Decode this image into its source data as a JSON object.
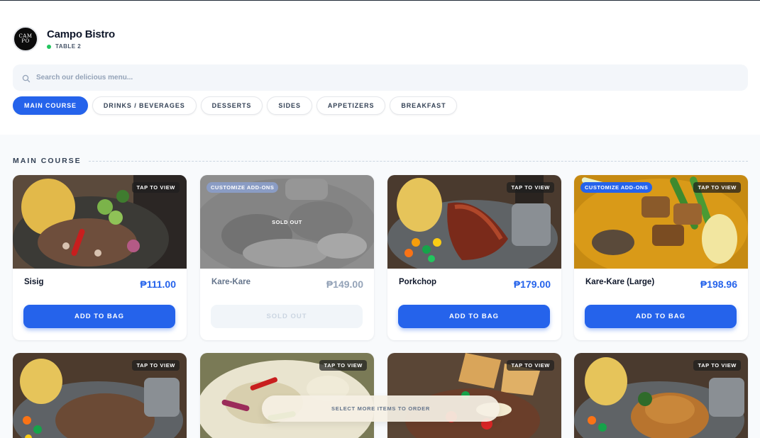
{
  "brand": {
    "name": "Campo Bistro",
    "logo_text": "CAM PO",
    "table": "TABLE 2",
    "table_status_color": "#22c55e"
  },
  "search": {
    "placeholder": "Search our delicious menu..."
  },
  "tabs": [
    {
      "label": "MAIN COURSE",
      "active": true
    },
    {
      "label": "DRINKS / BEVERAGES",
      "active": false
    },
    {
      "label": "DESSERTS",
      "active": false
    },
    {
      "label": "SIDES",
      "active": false
    },
    {
      "label": "APPETIZERS",
      "active": false
    },
    {
      "label": "BREAKFAST",
      "active": false
    }
  ],
  "section": {
    "title": "MAIN COURSE"
  },
  "products": [
    {
      "name": "Sisig",
      "price": "₱111.00",
      "tap_label": "TAP TO VIEW",
      "button": "ADD TO BAG"
    },
    {
      "name": "Kare-Kare",
      "price": "₱149.00",
      "custom_label": "CUSTOMIZE ADD-ONS",
      "overlay": "SOLD OUT",
      "button": "SOLD OUT",
      "sold_out": true
    },
    {
      "name": "Porkchop",
      "price": "₱179.00",
      "tap_label": "TAP TO VIEW",
      "button": "ADD TO BAG"
    },
    {
      "name": "Kare-Kare (Large)",
      "price": "₱198.96",
      "custom_label": "CUSTOMIZE ADD-ONS",
      "tap_label": "TAP TO VIEW",
      "button": "ADD TO BAG"
    },
    {
      "tap_label": "TAP TO VIEW"
    },
    {
      "tap_label": "TAP TO VIEW"
    },
    {
      "tap_label": "TAP TO VIEW"
    },
    {
      "tap_label": "TAP TO VIEW"
    }
  ],
  "cart_bar": {
    "label": "SELECT MORE ITEMS TO ORDER"
  },
  "colors": {
    "accent": "#2563eb",
    "muted_badge": "#8a9cc4",
    "background": "#f8fafc"
  }
}
